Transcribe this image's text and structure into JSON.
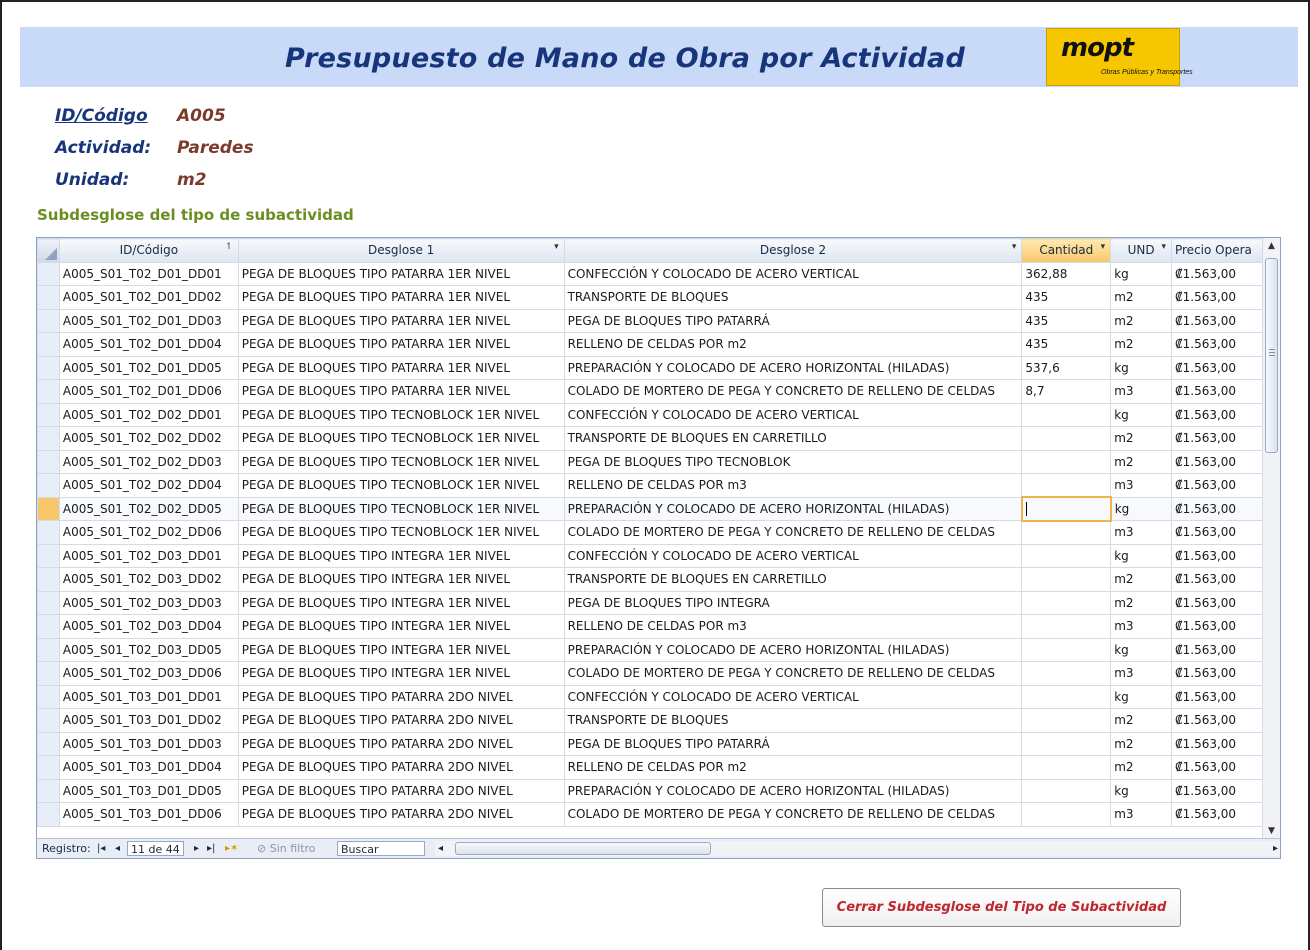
{
  "header": {
    "title": "Presupuesto de Mano de Obra por Actividad",
    "logo": {
      "main": "mopt",
      "sub": "Obras Públicas y Transportes"
    }
  },
  "info": {
    "id_label": "ID/Código",
    "id_value": "A005",
    "activity_label": "Actividad:",
    "activity_value": "Paredes",
    "unit_label": "Unidad:",
    "unit_value": "m2"
  },
  "section_title": "Subdesglose del tipo de subactividad",
  "columns": [
    "ID/Código",
    "Desglose 1",
    "Desglose 2",
    "Cantidad",
    "UND",
    "Precio Opera"
  ],
  "rows": [
    [
      "A005_S01_T02_D01_DD01",
      "PEGA DE BLOQUES TIPO PATARRA 1ER NIVEL",
      "CONFECCIÓN Y COLOCADO DE ACERO VERTICAL",
      "362,88",
      "kg",
      "₡1.563,00"
    ],
    [
      "A005_S01_T02_D01_DD02",
      "PEGA DE BLOQUES TIPO PATARRA 1ER NIVEL",
      "TRANSPORTE DE BLOQUES",
      "435",
      "m2",
      "₡1.563,00"
    ],
    [
      "A005_S01_T02_D01_DD03",
      "PEGA DE BLOQUES TIPO PATARRA 1ER NIVEL",
      "PEGA DE BLOQUES TIPO PATARRÁ",
      "435",
      "m2",
      "₡1.563,00"
    ],
    [
      "A005_S01_T02_D01_DD04",
      "PEGA DE BLOQUES TIPO PATARRA 1ER NIVEL",
      "RELLENO DE CELDAS POR m2",
      "435",
      "m2",
      "₡1.563,00"
    ],
    [
      "A005_S01_T02_D01_DD05",
      "PEGA DE BLOQUES TIPO PATARRA 1ER NIVEL",
      "PREPARACIÓN Y COLOCADO DE ACERO HORIZONTAL (HILADAS)",
      "537,6",
      "kg",
      "₡1.563,00"
    ],
    [
      "A005_S01_T02_D01_DD06",
      "PEGA DE BLOQUES TIPO PATARRA 1ER NIVEL",
      "COLADO DE MORTERO DE PEGA Y CONCRETO DE RELLENO DE CELDAS",
      "8,7",
      "m3",
      "₡1.563,00"
    ],
    [
      "A005_S01_T02_D02_DD01",
      "PEGA DE BLOQUES TIPO TECNOBLOCK 1ER NIVEL",
      "CONFECCIÓN Y COLOCADO DE ACERO VERTICAL",
      "",
      "kg",
      "₡1.563,00"
    ],
    [
      "A005_S01_T02_D02_DD02",
      "PEGA DE BLOQUES TIPO TECNOBLOCK 1ER NIVEL",
      "TRANSPORTE DE BLOQUES EN CARRETILLO",
      "",
      "m2",
      "₡1.563,00"
    ],
    [
      "A005_S01_T02_D02_DD03",
      "PEGA DE BLOQUES TIPO TECNOBLOCK 1ER NIVEL",
      "PEGA DE BLOQUES TIPO TECNOBLOK",
      "",
      "m2",
      "₡1.563,00"
    ],
    [
      "A005_S01_T02_D02_DD04",
      "PEGA DE BLOQUES TIPO TECNOBLOCK 1ER NIVEL",
      "RELLENO DE CELDAS POR m3",
      "",
      "m3",
      "₡1.563,00"
    ],
    [
      "A005_S01_T02_D02_DD05",
      "PEGA DE BLOQUES TIPO TECNOBLOCK 1ER NIVEL",
      "PREPARACIÓN Y COLOCADO DE ACERO HORIZONTAL (HILADAS)",
      "",
      "kg",
      "₡1.563,00"
    ],
    [
      "A005_S01_T02_D02_DD06",
      "PEGA DE BLOQUES TIPO TECNOBLOCK 1ER NIVEL",
      "COLADO DE MORTERO DE PEGA Y CONCRETO DE RELLENO DE CELDAS",
      "",
      "m3",
      "₡1.563,00"
    ],
    [
      "A005_S01_T02_D03_DD01",
      "PEGA DE BLOQUES TIPO INTEGRA 1ER NIVEL",
      "CONFECCIÓN Y COLOCADO DE ACERO VERTICAL",
      "",
      "kg",
      "₡1.563,00"
    ],
    [
      "A005_S01_T02_D03_DD02",
      "PEGA DE BLOQUES TIPO INTEGRA 1ER NIVEL",
      "TRANSPORTE DE BLOQUES EN CARRETILLO",
      "",
      "m2",
      "₡1.563,00"
    ],
    [
      "A005_S01_T02_D03_DD03",
      "PEGA DE BLOQUES TIPO INTEGRA 1ER NIVEL",
      "PEGA DE BLOQUES TIPO INTEGRA",
      "",
      "m2",
      "₡1.563,00"
    ],
    [
      "A005_S01_T02_D03_DD04",
      "PEGA DE BLOQUES TIPO INTEGRA 1ER NIVEL",
      "RELLENO DE CELDAS POR m3",
      "",
      "m3",
      "₡1.563,00"
    ],
    [
      "A005_S01_T02_D03_DD05",
      "PEGA DE BLOQUES TIPO INTEGRA 1ER NIVEL",
      "PREPARACIÓN Y COLOCADO DE ACERO HORIZONTAL (HILADAS)",
      "",
      "kg",
      "₡1.563,00"
    ],
    [
      "A005_S01_T02_D03_DD06",
      "PEGA DE BLOQUES TIPO INTEGRA 1ER NIVEL",
      "COLADO DE MORTERO DE PEGA Y CONCRETO DE RELLENO DE CELDAS",
      "",
      "m3",
      "₡1.563,00"
    ],
    [
      "A005_S01_T03_D01_DD01",
      "PEGA DE BLOQUES TIPO PATARRA 2DO NIVEL",
      "CONFECCIÓN Y COLOCADO DE ACERO VERTICAL",
      "",
      "kg",
      "₡1.563,00"
    ],
    [
      "A005_S01_T03_D01_DD02",
      "PEGA DE BLOQUES TIPO PATARRA 2DO NIVEL",
      "TRANSPORTE DE BLOQUES",
      "",
      "m2",
      "₡1.563,00"
    ],
    [
      "A005_S01_T03_D01_DD03",
      "PEGA DE BLOQUES TIPO PATARRA 2DO NIVEL",
      "PEGA DE BLOQUES TIPO PATARRÁ",
      "",
      "m2",
      "₡1.563,00"
    ],
    [
      "A005_S01_T03_D01_DD04",
      "PEGA DE BLOQUES TIPO PATARRA 2DO NIVEL",
      "RELLENO DE CELDAS POR m2",
      "",
      "m2",
      "₡1.563,00"
    ],
    [
      "A005_S01_T03_D01_DD05",
      "PEGA DE BLOQUES TIPO PATARRA 2DO NIVEL",
      "PREPARACIÓN Y COLOCADO DE ACERO HORIZONTAL (HILADAS)",
      "",
      "kg",
      "₡1.563,00"
    ],
    [
      "A005_S01_T03_D01_DD06",
      "PEGA DE BLOQUES TIPO PATARRA 2DO NIVEL",
      "COLADO DE MORTERO DE PEGA Y CONCRETO DE RELLENO DE CELDAS",
      "",
      "m3",
      "₡1.563,00"
    ]
  ],
  "active_row": 10,
  "navbar": {
    "record_label": "Registro:",
    "record_value": "11 de 44",
    "no_filter": "Sin filtro",
    "search": "Buscar"
  },
  "close_button": "Cerrar Subdesglose del Tipo de Subactividad",
  "colors": {
    "title": "#17357a",
    "value": "#7b3b2b",
    "section": "#6b8e23",
    "close_text": "#c0262d",
    "header_band": "#c9daf8"
  }
}
